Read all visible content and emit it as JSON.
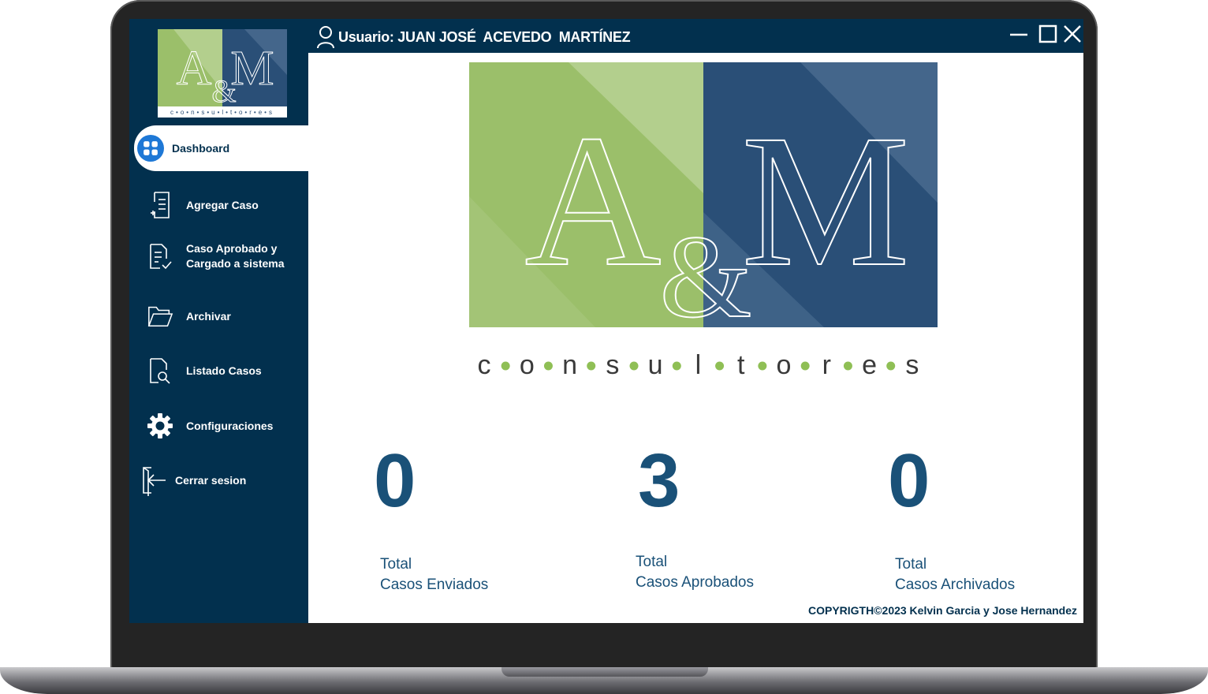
{
  "window": {
    "user_label": "Usuario: JUAN JOSÉ  ACEVEDO  MARTÍNEZ"
  },
  "brand": {
    "logo_letters": "A&M",
    "letter_a": "A",
    "ampersand": "&",
    "letter_m": "M",
    "tagline": "consultores",
    "colors": {
      "green_dark": "#9bbf6a",
      "green_light": "#b3cf8d",
      "navy_dark": "#2a4f77",
      "navy_light": "#44668b",
      "dot": "#8fbf55"
    }
  },
  "sidebar": {
    "items": [
      {
        "label": "Dashboard",
        "icon": "dashboard-icon",
        "active": true
      },
      {
        "label": "Agregar Caso",
        "icon": "add-document-icon"
      },
      {
        "label_line1": "Caso Aprobado y",
        "label_line2": "Cargado a sistema",
        "icon": "approved-document-icon"
      },
      {
        "label": "Archivar",
        "icon": "folder-icon"
      },
      {
        "label": "Listado Casos",
        "icon": "search-document-icon"
      },
      {
        "label": "Configuraciones",
        "icon": "gear-icon"
      },
      {
        "label": "Cerrar sesion",
        "icon": "logout-icon"
      }
    ]
  },
  "stats": [
    {
      "value": "0",
      "line1": "Total",
      "line2": "Casos Enviados"
    },
    {
      "value": "3",
      "line1": "Total",
      "line2": "Casos Aprobados"
    },
    {
      "value": "0",
      "line1": "Total",
      "line2": "Casos Archivados"
    }
  ],
  "footer": {
    "copyright": "COPYRIGTH©2023 Kelvin Garcia y Jose Hernandez"
  }
}
